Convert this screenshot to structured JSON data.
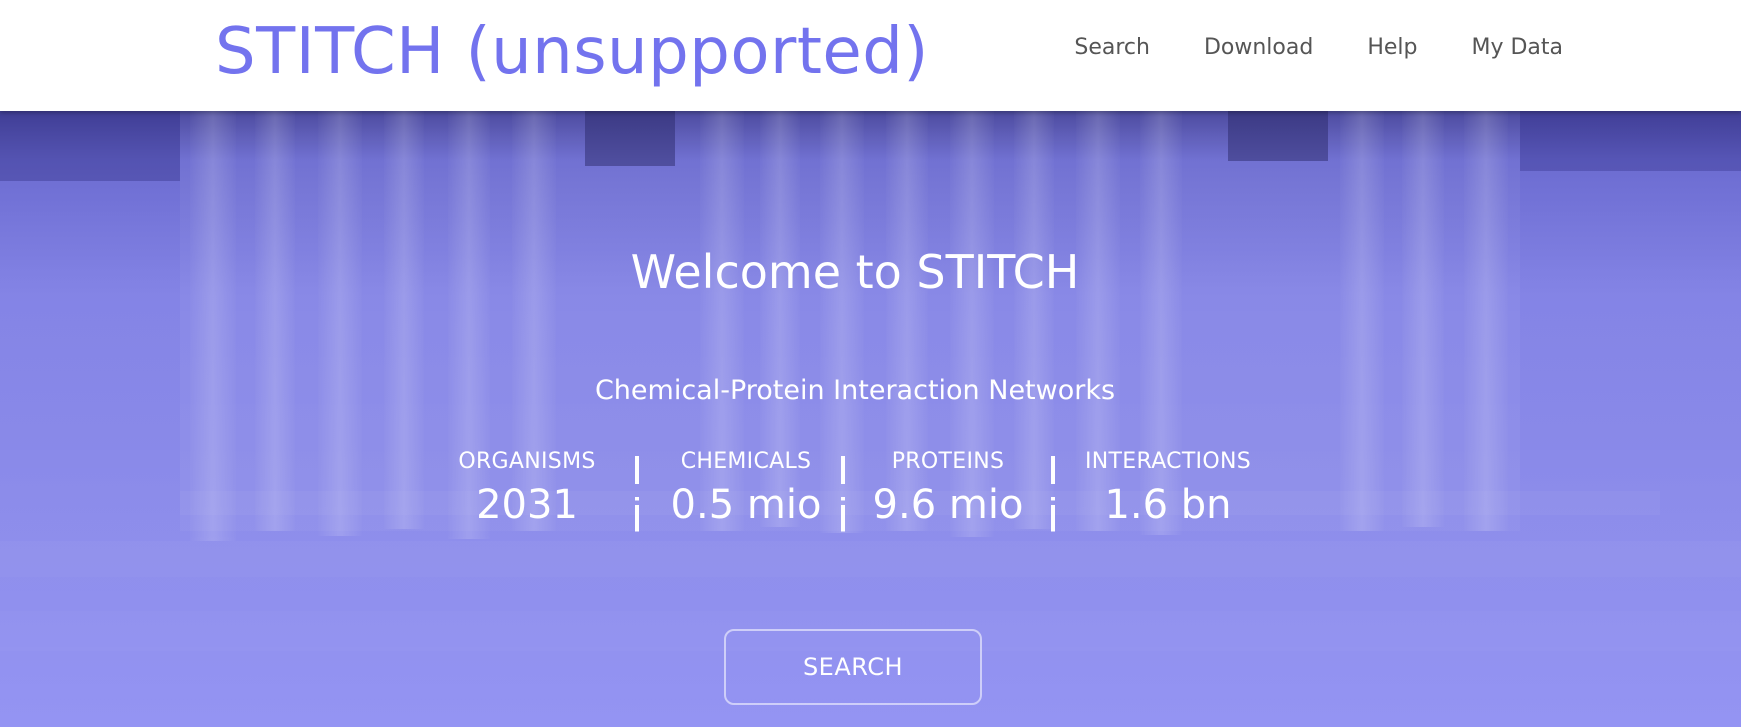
{
  "brand": {
    "title": "STITCH (unsupported)"
  },
  "nav": {
    "items": [
      {
        "label": "Search"
      },
      {
        "label": "Download"
      },
      {
        "label": "Help"
      },
      {
        "label": "My Data"
      }
    ]
  },
  "hero": {
    "welcome": "Welcome to STITCH",
    "subtitle": "Chemical-Protein Interaction Networks",
    "stats": [
      {
        "label": "ORGANISMS",
        "value": "2031"
      },
      {
        "label": "CHEMICALS",
        "value": "0.5 mio"
      },
      {
        "label": "PROTEINS",
        "value": "9.6 mio"
      },
      {
        "label": "INTERACTIONS",
        "value": "1.6 bn"
      }
    ],
    "search_button": "SEARCH"
  },
  "colors": {
    "brand": "#7373ee",
    "nav_text": "#555555",
    "hero_overlay": "#6a6ae6",
    "hero_text": "#ffffff"
  }
}
